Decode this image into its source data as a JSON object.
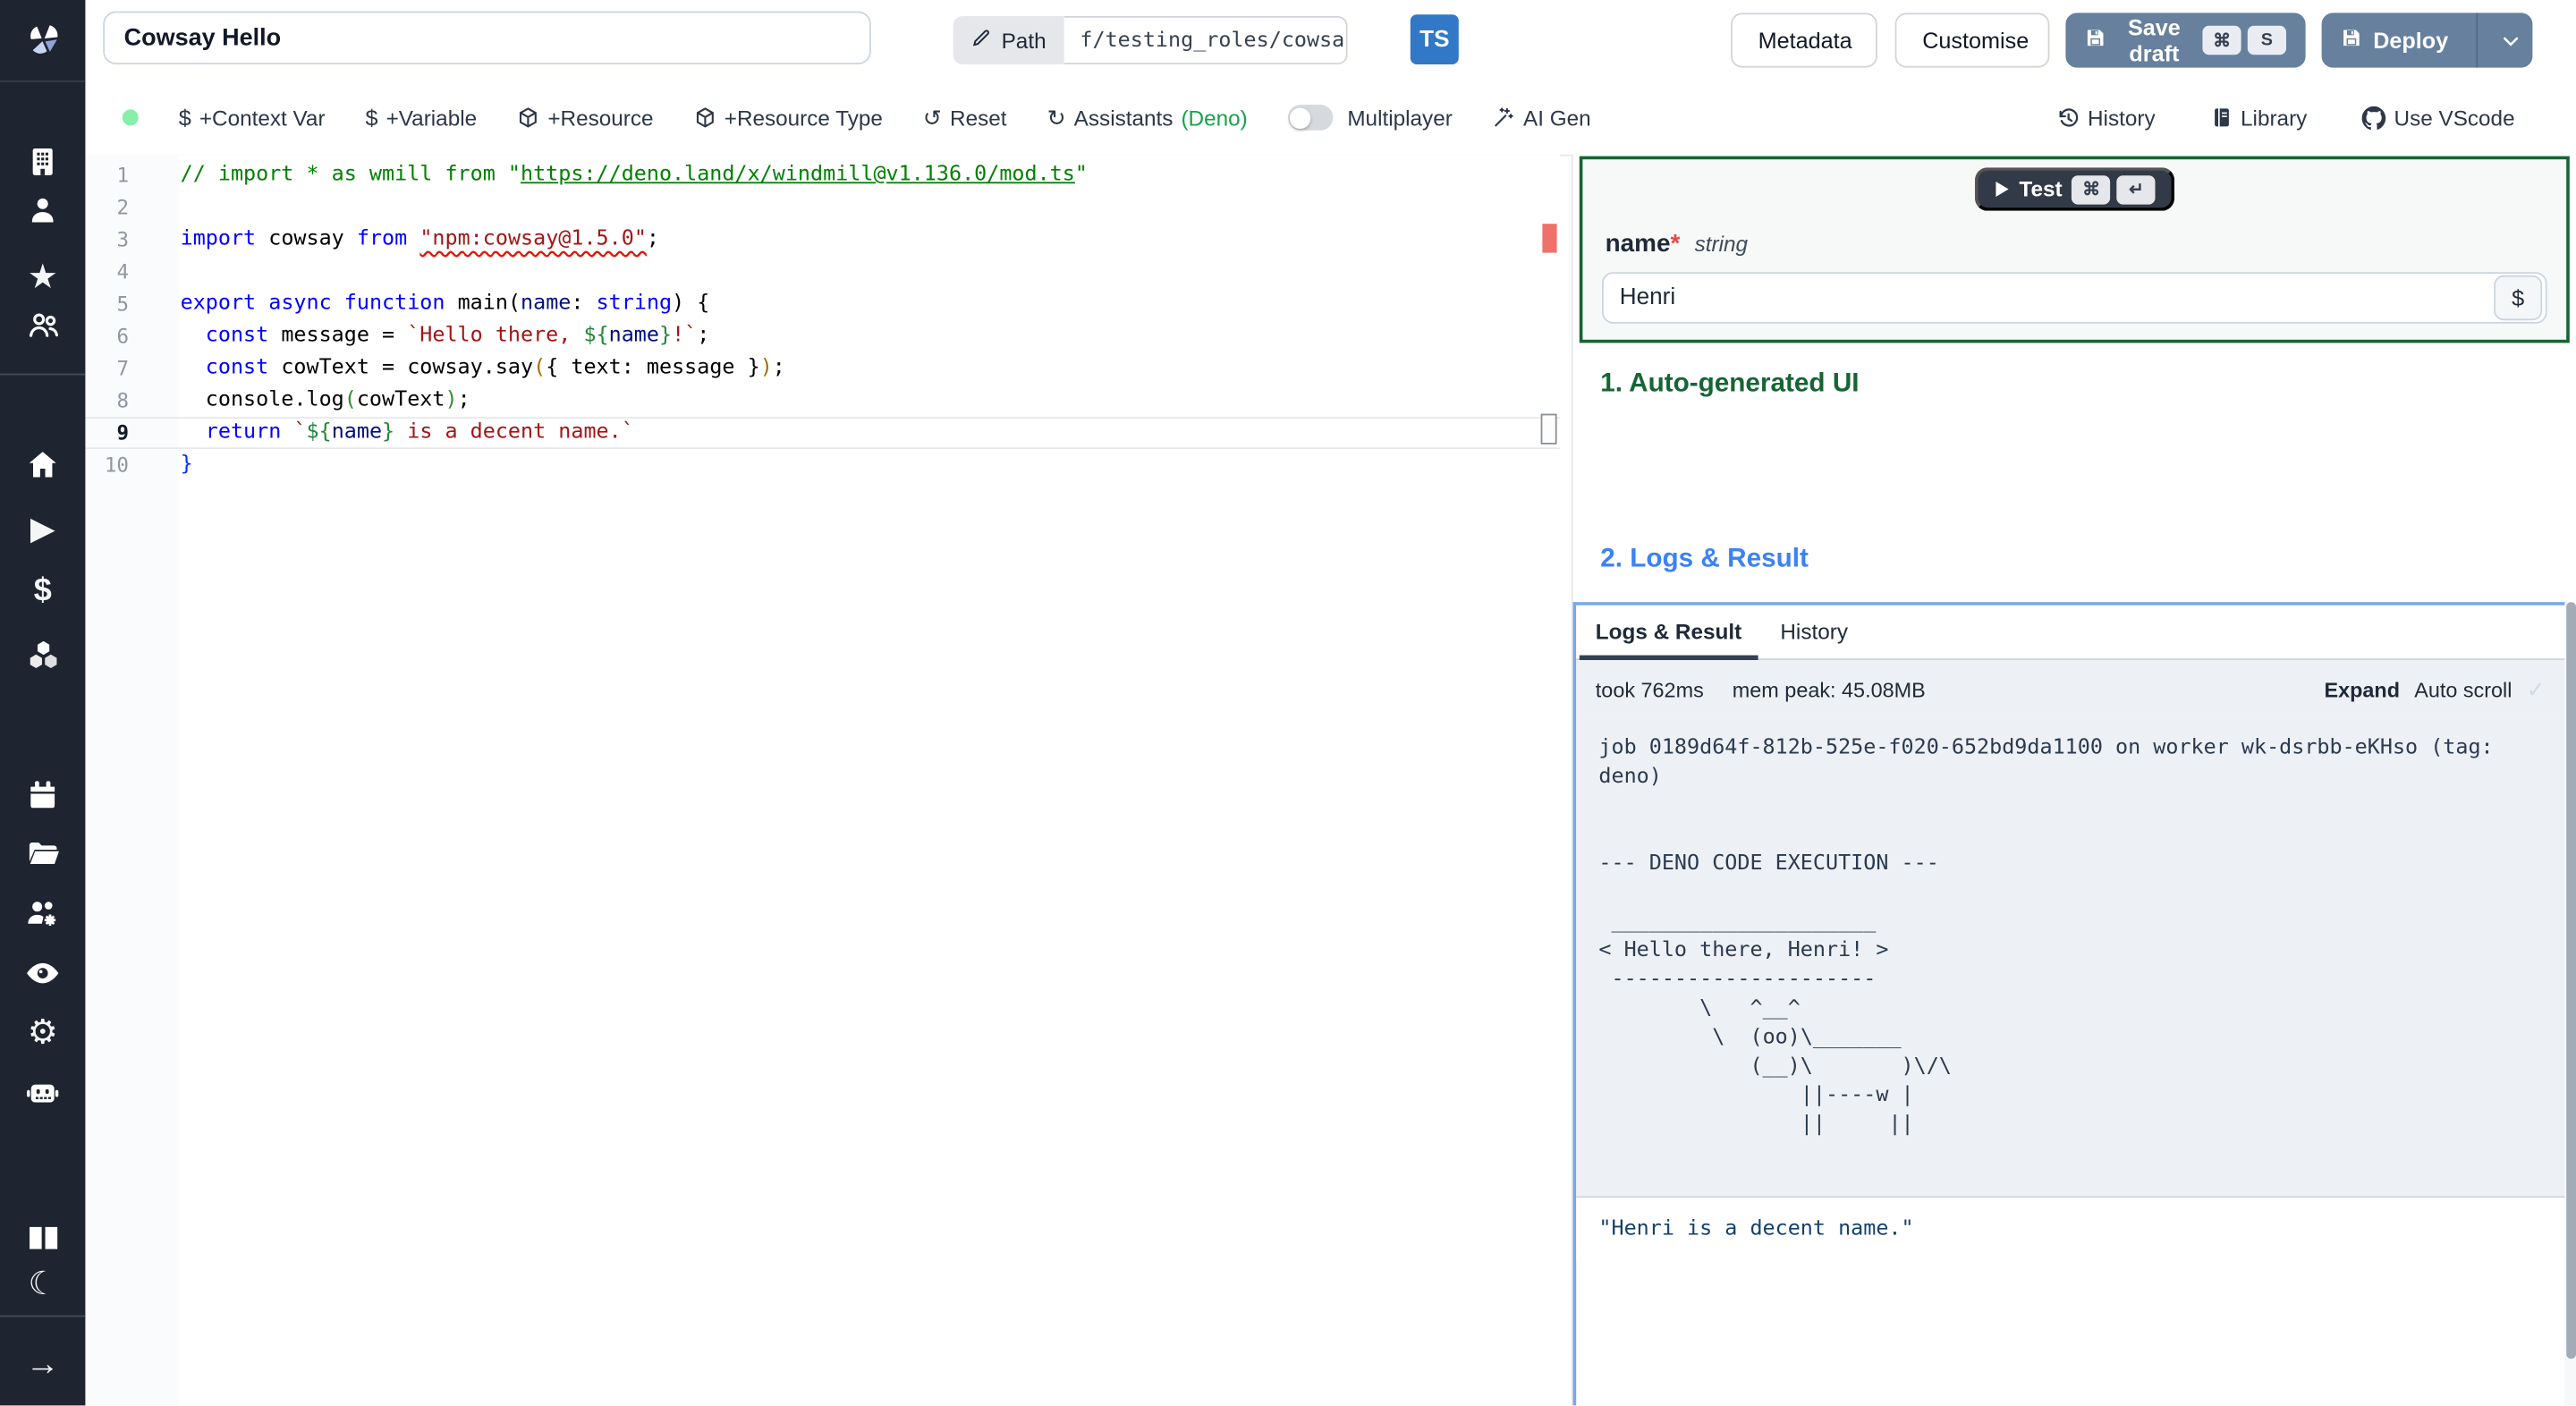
{
  "topbar": {
    "title_value": "Cowsay Hello",
    "path_label": "Path",
    "path_value": "f/testing_roles/cowsa",
    "ts_badge": "TS",
    "metadata": "Metadata",
    "customise": "Customise",
    "save_draft": "Save draft",
    "save_kbd": [
      "⌘",
      "S"
    ],
    "deploy": "Deploy"
  },
  "toolbar": {
    "dollar": "$",
    "context_var": "+Context Var",
    "variable": "+Variable",
    "resource": "+Resource",
    "resource_type": "+Resource Type",
    "reset_icon": "↺",
    "reset": "Reset",
    "assistants_icon": "↻",
    "assistants": "Assistants",
    "assistants_lang": "(Deno)",
    "multiplayer": "Multiplayer",
    "ai_gen": "AI Gen",
    "history": "History",
    "library": "Library",
    "vscode": "Use VScode"
  },
  "sidebar": {
    "icons": [
      "windmill-logo",
      "workspace-building",
      "user",
      "star",
      "user-groups",
      "home",
      "runs-play",
      "variables-dollar",
      "resources-cubes",
      "schedules-calendar",
      "folders",
      "groups-gear",
      "audit-eye",
      "settings-gear",
      "ai-robot",
      "docs-book",
      "dark-mode-moon",
      "expand-arrow"
    ],
    "play_glyph": "▶",
    "dollar_glyph": "$",
    "star_glyph": "★",
    "gear_glyph": "⚙",
    "moon_glyph": "☾",
    "arrow_glyph": "→"
  },
  "editor": {
    "current_line": 9,
    "lines": [
      {
        "n": 1,
        "tokens": [
          {
            "t": "// import * as wmill from \"",
            "c": "c"
          },
          {
            "t": "https://deno.land/x/windmill@v1.136.0/mod.ts",
            "c": "cu"
          },
          {
            "t": "\"",
            "c": "c"
          }
        ]
      },
      {
        "n": 2,
        "tokens": []
      },
      {
        "n": 3,
        "tokens": [
          {
            "t": "import",
            "c": "k"
          },
          {
            "t": " cowsay "
          },
          {
            "t": "from",
            "c": "k"
          },
          {
            "t": " "
          },
          {
            "t": "\"npm:cowsay@1.5.0\"",
            "c": "s sq"
          },
          {
            "t": ";"
          }
        ]
      },
      {
        "n": 4,
        "tokens": []
      },
      {
        "n": 5,
        "tokens": [
          {
            "t": "export",
            "c": "k"
          },
          {
            "t": " "
          },
          {
            "t": "async",
            "c": "k"
          },
          {
            "t": " "
          },
          {
            "t": "function",
            "c": "k"
          },
          {
            "t": " main("
          },
          {
            "t": "name",
            "c": "v"
          },
          {
            "t": ": "
          },
          {
            "t": "string",
            "c": "k"
          },
          {
            "t": ") {"
          }
        ]
      },
      {
        "n": 6,
        "tokens": [
          {
            "t": "  "
          },
          {
            "t": "const",
            "c": "k"
          },
          {
            "t": " message = "
          },
          {
            "t": "`Hello there, ",
            "c": "s"
          },
          {
            "t": "${",
            "c": "d"
          },
          {
            "t": "name",
            "c": "v"
          },
          {
            "t": "}",
            "c": "d"
          },
          {
            "t": "!`",
            "c": "s"
          },
          {
            "t": ";"
          }
        ]
      },
      {
        "n": 7,
        "tokens": [
          {
            "t": "  "
          },
          {
            "t": "const",
            "c": "k"
          },
          {
            "t": " cowText = cowsay.say"
          },
          {
            "t": "(",
            "c": "po"
          },
          {
            "t": "{ text: message }"
          },
          {
            "t": ")",
            "c": "po"
          },
          {
            "t": ";"
          }
        ]
      },
      {
        "n": 8,
        "tokens": [
          {
            "t": "  console.log"
          },
          {
            "t": "(",
            "c": "pg"
          },
          {
            "t": "cowText"
          },
          {
            "t": ")",
            "c": "pg"
          },
          {
            "t": ";"
          }
        ]
      },
      {
        "n": 9,
        "tokens": [
          {
            "t": "  "
          },
          {
            "t": "return",
            "c": "k"
          },
          {
            "t": " "
          },
          {
            "t": "`",
            "c": "s"
          },
          {
            "t": "${",
            "c": "d"
          },
          {
            "t": "name",
            "c": "v"
          },
          {
            "t": "}",
            "c": "d"
          },
          {
            "t": " is a decent name.`",
            "c": "s"
          }
        ]
      },
      {
        "n": 10,
        "tokens": [
          {
            "t": "}",
            "c": "pb"
          }
        ]
      }
    ]
  },
  "panel": {
    "test": "Test",
    "test_kbd": [
      "⌘",
      "↵"
    ],
    "field": {
      "name": "name",
      "req": "*",
      "type": "string",
      "value": "Henri",
      "dollar": "$"
    },
    "sec1": "1. Auto-generated UI",
    "sec2": "2. Logs & Result",
    "tabs": {
      "logs": "Logs & Result",
      "history": "History"
    },
    "meta": {
      "took": "took 762ms",
      "mem": "mem peak: 45.08MB",
      "expand": "Expand",
      "autoscroll": "Auto scroll",
      "check": "✓"
    },
    "log_text": "job 0189d64f-812b-525e-f020-652bd9da1100 on worker wk-dsrbb-eKHso (tag: deno)\n\n\n--- DENO CODE EXECUTION ---\n\n _____________________\n< Hello there, Henri! >\n ---------------------\n        \\   ^__^\n         \\  (oo)\\_______\n            (__)\\       )\\/\\\n                ||----w |\n                ||     ||",
    "result": "\"Henri is a decent name.\""
  },
  "colors": {
    "sidebar_bg": "#1e2430",
    "primary_button": "#66809e",
    "test_button": "#333a47",
    "form_border_green": "#166534",
    "section_green": "#166534",
    "section_blue": "#3b82f6",
    "logs_focus_blue": "#79a7ee",
    "status_dot_green": "#86efac",
    "ts_blue": "#3178c6",
    "error_marker_red": "#f0706a"
  }
}
